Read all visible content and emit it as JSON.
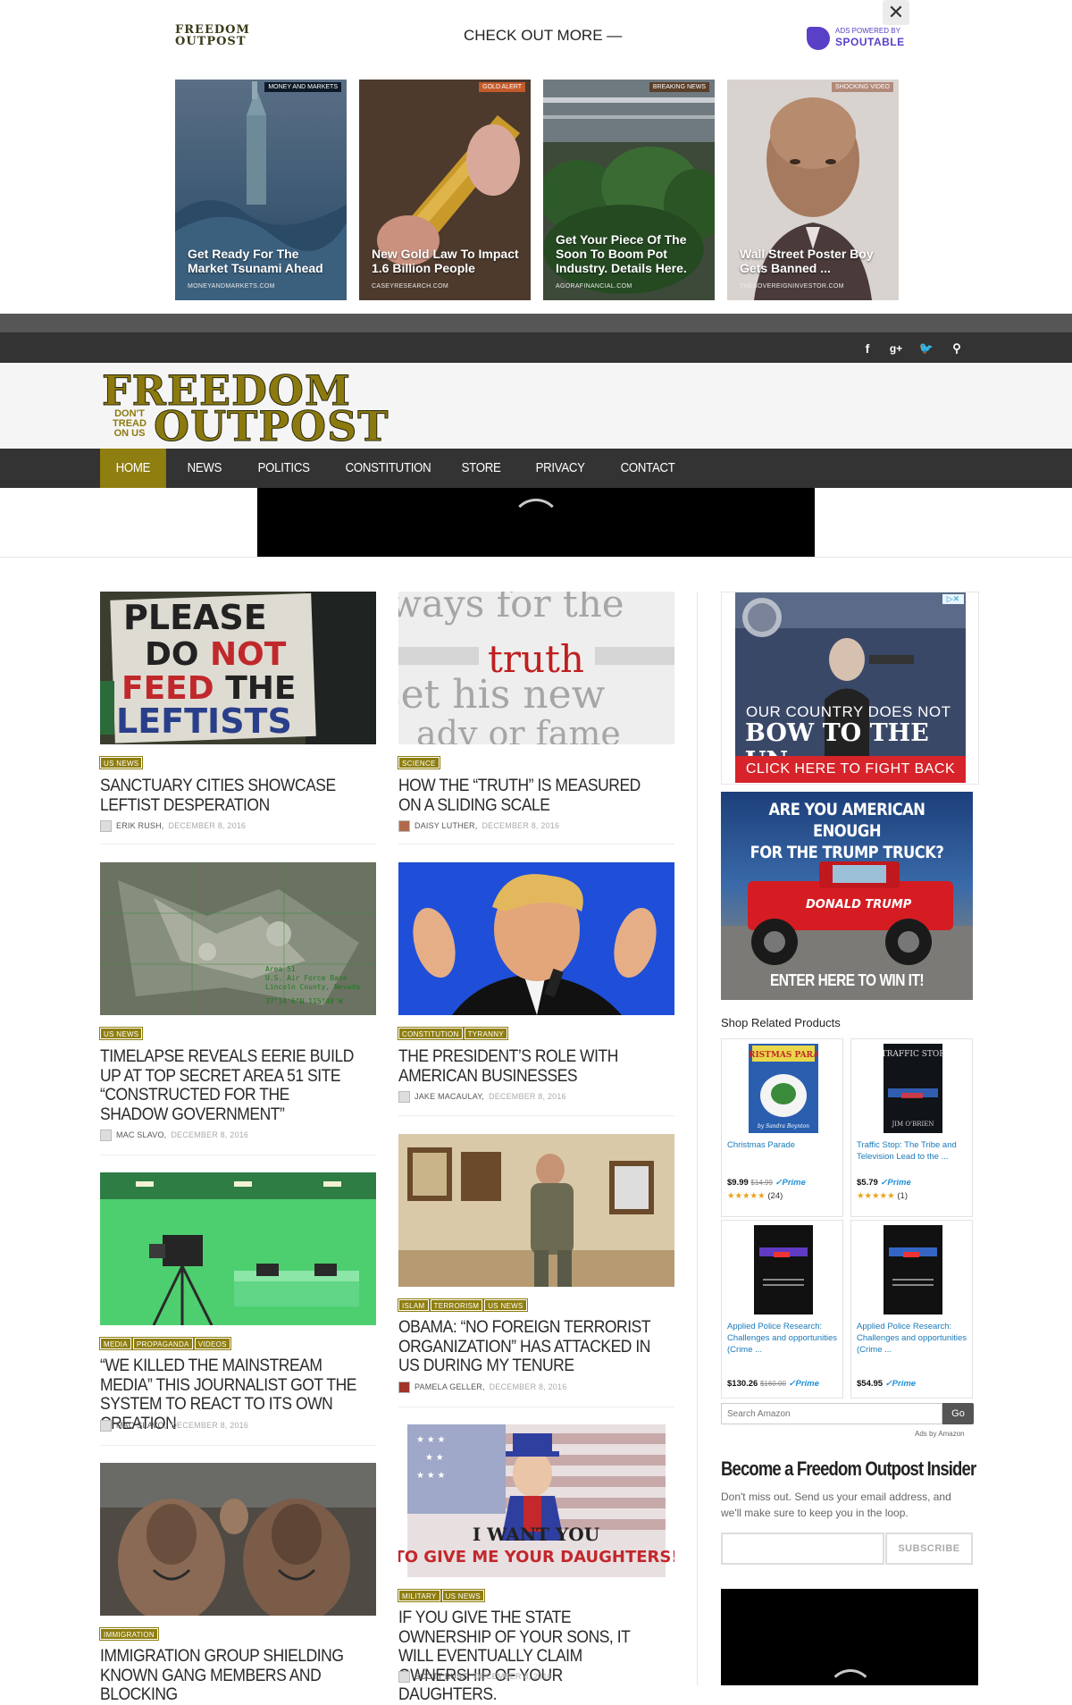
{
  "promo": {
    "logo_line1": "FREEDOM",
    "logo_line2": "OUTPOST",
    "check_label": "CHECK OUT MORE —",
    "spout_small": "ADS POWERED BY",
    "spout_big": "SPOUTABLE",
    "close_label": "✕",
    "cards": [
      {
        "tag": "MONEY AND MARKETS",
        "title": "Get Ready For The Market Tsunami Ahead",
        "source": "MONEYANDMARKETS.COM",
        "tag_color": "#0e1a27"
      },
      {
        "tag": "GOLD ALERT",
        "title": "New Gold Law To Impact 1.6 Billion People",
        "source": "CASEYRESEARCH.COM",
        "tag_color": "#c25a2a"
      },
      {
        "tag": "BREAKING NEWS",
        "title": "Get Your Piece Of The Soon To Boom Pot Industry. Details Here.",
        "source": "AGORAFINANCIAL.COM",
        "tag_color": "#5a3f2a"
      },
      {
        "tag": "SHOCKING VIDEO",
        "title": "Wall Street Poster Boy Gets Banned ...",
        "source": "THESOVEREIGNINVESTOR.COM",
        "tag_color": "#b28a7a"
      }
    ]
  },
  "social": {
    "facebook": "f",
    "gplus": "g+",
    "twitter": "🐦",
    "search": "⚲"
  },
  "logo": {
    "line1": "FREEDOM",
    "line2": "OUTPOST",
    "tagline": "DON'T TREAD ON US"
  },
  "nav": {
    "items": [
      "HOME",
      "NEWS",
      "POLITICS",
      "CONSTITUTION",
      "STORE",
      "PRIVACY",
      "CONTACT"
    ]
  },
  "articles": {
    "left": [
      {
        "cats": [
          "US NEWS"
        ],
        "title": "SANCTUARY CITIES SHOWCASE LEFTIST DESPERATION",
        "author": "ERIK RUSH,",
        "date": "DECEMBER 8, 2016",
        "img_text": "PLEASE DO NOT FEED THE LEFTISTS"
      },
      {
        "cats": [
          "US NEWS"
        ],
        "title": "TIMELAPSE REVEALS EERIE BUILD UP AT TOP SECRET AREA 51 SITE “CONSTRUCTED FOR THE SHADOW GOVERNMENT”",
        "author": "MAC SLAVO,",
        "date": "DECEMBER 8, 2016",
        "img_text": "Area 51 U.S. Air Force Base Lincoln County, Nevada 37°14'6\"N 115°48'W"
      },
      {
        "cats": [
          "MEDIA",
          "PROPAGANDA",
          "VIDEOS"
        ],
        "title": "“WE KILLED THE MAINSTREAM MEDIA” THIS JOURNALIST GOT THE SYSTEM TO REACT TO ITS OWN CREATION",
        "author": "MAC SLAVO,",
        "date": "DECEMBER 8, 2016"
      },
      {
        "cats": [
          "IMMIGRATION"
        ],
        "title": "IMMIGRATION GROUP SHIELDING KNOWN GANG MEMBERS AND BLOCKING",
        "author": "",
        "date": ""
      }
    ],
    "right": [
      {
        "cats": [
          "SCIENCE"
        ],
        "title": "HOW THE “TRUTH” IS MEASURED ON A SLIDING SCALE",
        "author": "DAISY LUTHER,",
        "date": "DECEMBER 8, 2016",
        "img_text": "truth"
      },
      {
        "cats": [
          "CONSTITUTION",
          "TYRANNY"
        ],
        "title": "THE PRESIDENT’S ROLE WITH AMERICAN BUSINESSES",
        "author": "JAKE MACAULAY,",
        "date": "DECEMBER 8, 2016"
      },
      {
        "cats": [
          "ISLAM",
          "TERRORISM",
          "US NEWS"
        ],
        "title": "OBAMA: “NO FOREIGN TERRORIST ORGANIZATION” HAS ATTACKED IN US DURING MY TENURE",
        "author": "PAMELA GELLER,",
        "date": "DECEMBER 8, 2016"
      },
      {
        "cats": [
          "MILITARY",
          "US NEWS"
        ],
        "title": "IF YOU GIVE THE STATE OWNERSHIP OF YOUR SONS, IT WILL EVENTUALLY CLAIM OWNERSHIP OF YOUR DAUGHTERS.",
        "author": "SCOTT BUSS,",
        "date": "DECEMBER 8, 2016",
        "img_text1": "I WANT YOU",
        "img_text2": "TO GIVE ME YOUR DAUGHTERS!"
      }
    ]
  },
  "sidebar": {
    "ad1": {
      "line1": "OUR COUNTRY DOES NOT",
      "line2": "BOW TO THE UN",
      "button": "CLICK HERE TO FIGHT BACK",
      "adchoice": "▷✕"
    },
    "ad2": {
      "line1": "ARE YOU AMERICAN ENOUGH",
      "line2": "FOR THE TRUMP TRUCK?",
      "footer": "ENTER HERE TO WIN IT!",
      "truck_text": "DONALD TRUMP"
    },
    "shop_title": "Shop Related Products",
    "products": [
      {
        "name": "Christmas Parade",
        "price": "$9.99",
        "old": "$14.99",
        "prime": "✓Prime",
        "stars": "★★★★★",
        "count": "(24)",
        "cover_title": "CHRISTMAS PARADE",
        "cover_author": "by Sandra Boynton"
      },
      {
        "name": "Traffic Stop: The Tribe and Television Lead to the ...",
        "price": "$5.79",
        "old": "",
        "prime": "✓Prime",
        "stars": "★★★★★",
        "count": "(1)",
        "cover_title": "TRAFFIC STOP",
        "cover_author": "JIM O'BRIEN"
      },
      {
        "name": "Applied Police Research: Challenges and opportunities (Crime ...",
        "price": "$130.26",
        "old": "$160.00",
        "prime": "✓Prime",
        "stars": "",
        "count": ""
      },
      {
        "name": "Applied Police Research: Challenges and opportunities (Crime ...",
        "price": "$54.95",
        "old": "",
        "prime": "✓Prime",
        "stars": "",
        "count": ""
      }
    ],
    "amazon_placeholder": "Search Amazon",
    "amazon_go": "Go",
    "amazon_note": "Ads by Amazon",
    "insider_title": "Become a Freedom Outpost Insider",
    "insider_text": "Don't miss out. Send us your email address, and we'll make sure to keep you in the loop.",
    "subscribe": "SUBSCRIBE"
  },
  "colors": {
    "accent": "#8f7e10",
    "nav_bg": "#333333",
    "red_button": "#d6242a"
  }
}
